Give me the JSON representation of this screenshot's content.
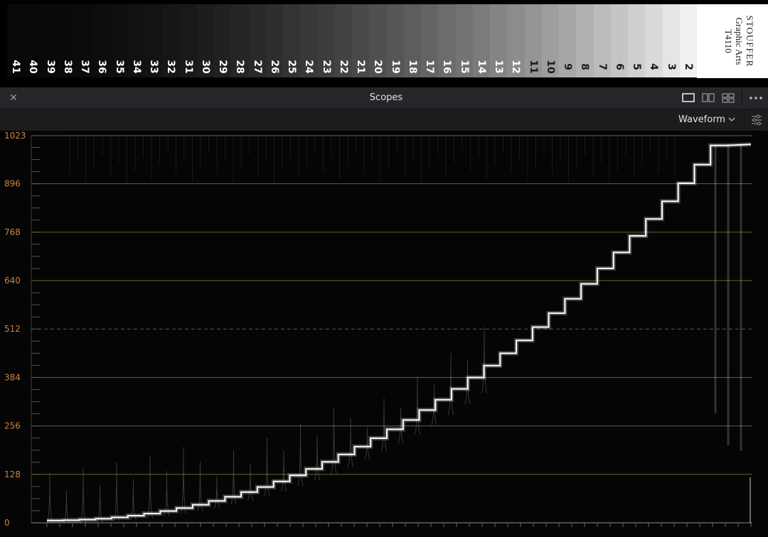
{
  "step_wedge": {
    "labels": [
      "41",
      "40",
      "39",
      "38",
      "37",
      "36",
      "35",
      "34",
      "33",
      "32",
      "31",
      "30",
      "29",
      "28",
      "27",
      "26",
      "25",
      "24",
      "23",
      "22",
      "21",
      "20",
      "19",
      "18",
      "17",
      "16",
      "15",
      "14",
      "13",
      "12",
      "11",
      "10",
      "9",
      "8",
      "7",
      "6",
      "5",
      "4",
      "3",
      "2"
    ],
    "brand_lines": [
      "STOUFFER",
      "Graphic Arts",
      "T4110"
    ]
  },
  "panel": {
    "title": "Scopes",
    "close_icon": "close-icon",
    "layout_buttons": [
      "single-layout-icon",
      "dual-layout-icon",
      "quad-layout-icon"
    ],
    "more_icon": "more-options-icon"
  },
  "toolbar": {
    "scope_type": "Waveform",
    "settings_icon": "settings-sliders-icon"
  },
  "waveform": {
    "y_axis_labels": [
      "1023",
      "896",
      "768",
      "640",
      "512",
      "384",
      "256",
      "128",
      "0"
    ],
    "axis_color": "#c8873a",
    "graticule_color": "#6b6035",
    "trace_color": "#ffffff"
  }
}
